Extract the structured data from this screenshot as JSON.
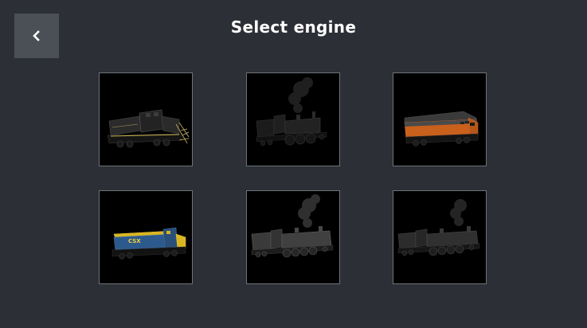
{
  "header": {
    "title": "Select engine",
    "back_icon": "chevron-left-icon"
  },
  "colors": {
    "background": "#2c2f35",
    "back_button": "#4b5056",
    "tile_background": "#000000",
    "tile_border": "#6e737a",
    "title_text": "#ffffff"
  },
  "engines": [
    {
      "name": "switcher-locomotive-dark",
      "livery_color": "#2a2a2a"
    },
    {
      "name": "steam-locomotive-dark",
      "livery_color": "#1e1e1e"
    },
    {
      "name": "diesel-locomotive-orange",
      "livery_color": "#d0641e"
    },
    {
      "name": "diesel-locomotive-blue-yellow",
      "livery_color": "#2d5a8c",
      "livery_text": "CSX"
    },
    {
      "name": "steam-locomotive-big-boy",
      "livery_color": "#3a3a3a"
    },
    {
      "name": "steam-locomotive-big-boy-dark",
      "livery_color": "#2a2a2a"
    }
  ]
}
